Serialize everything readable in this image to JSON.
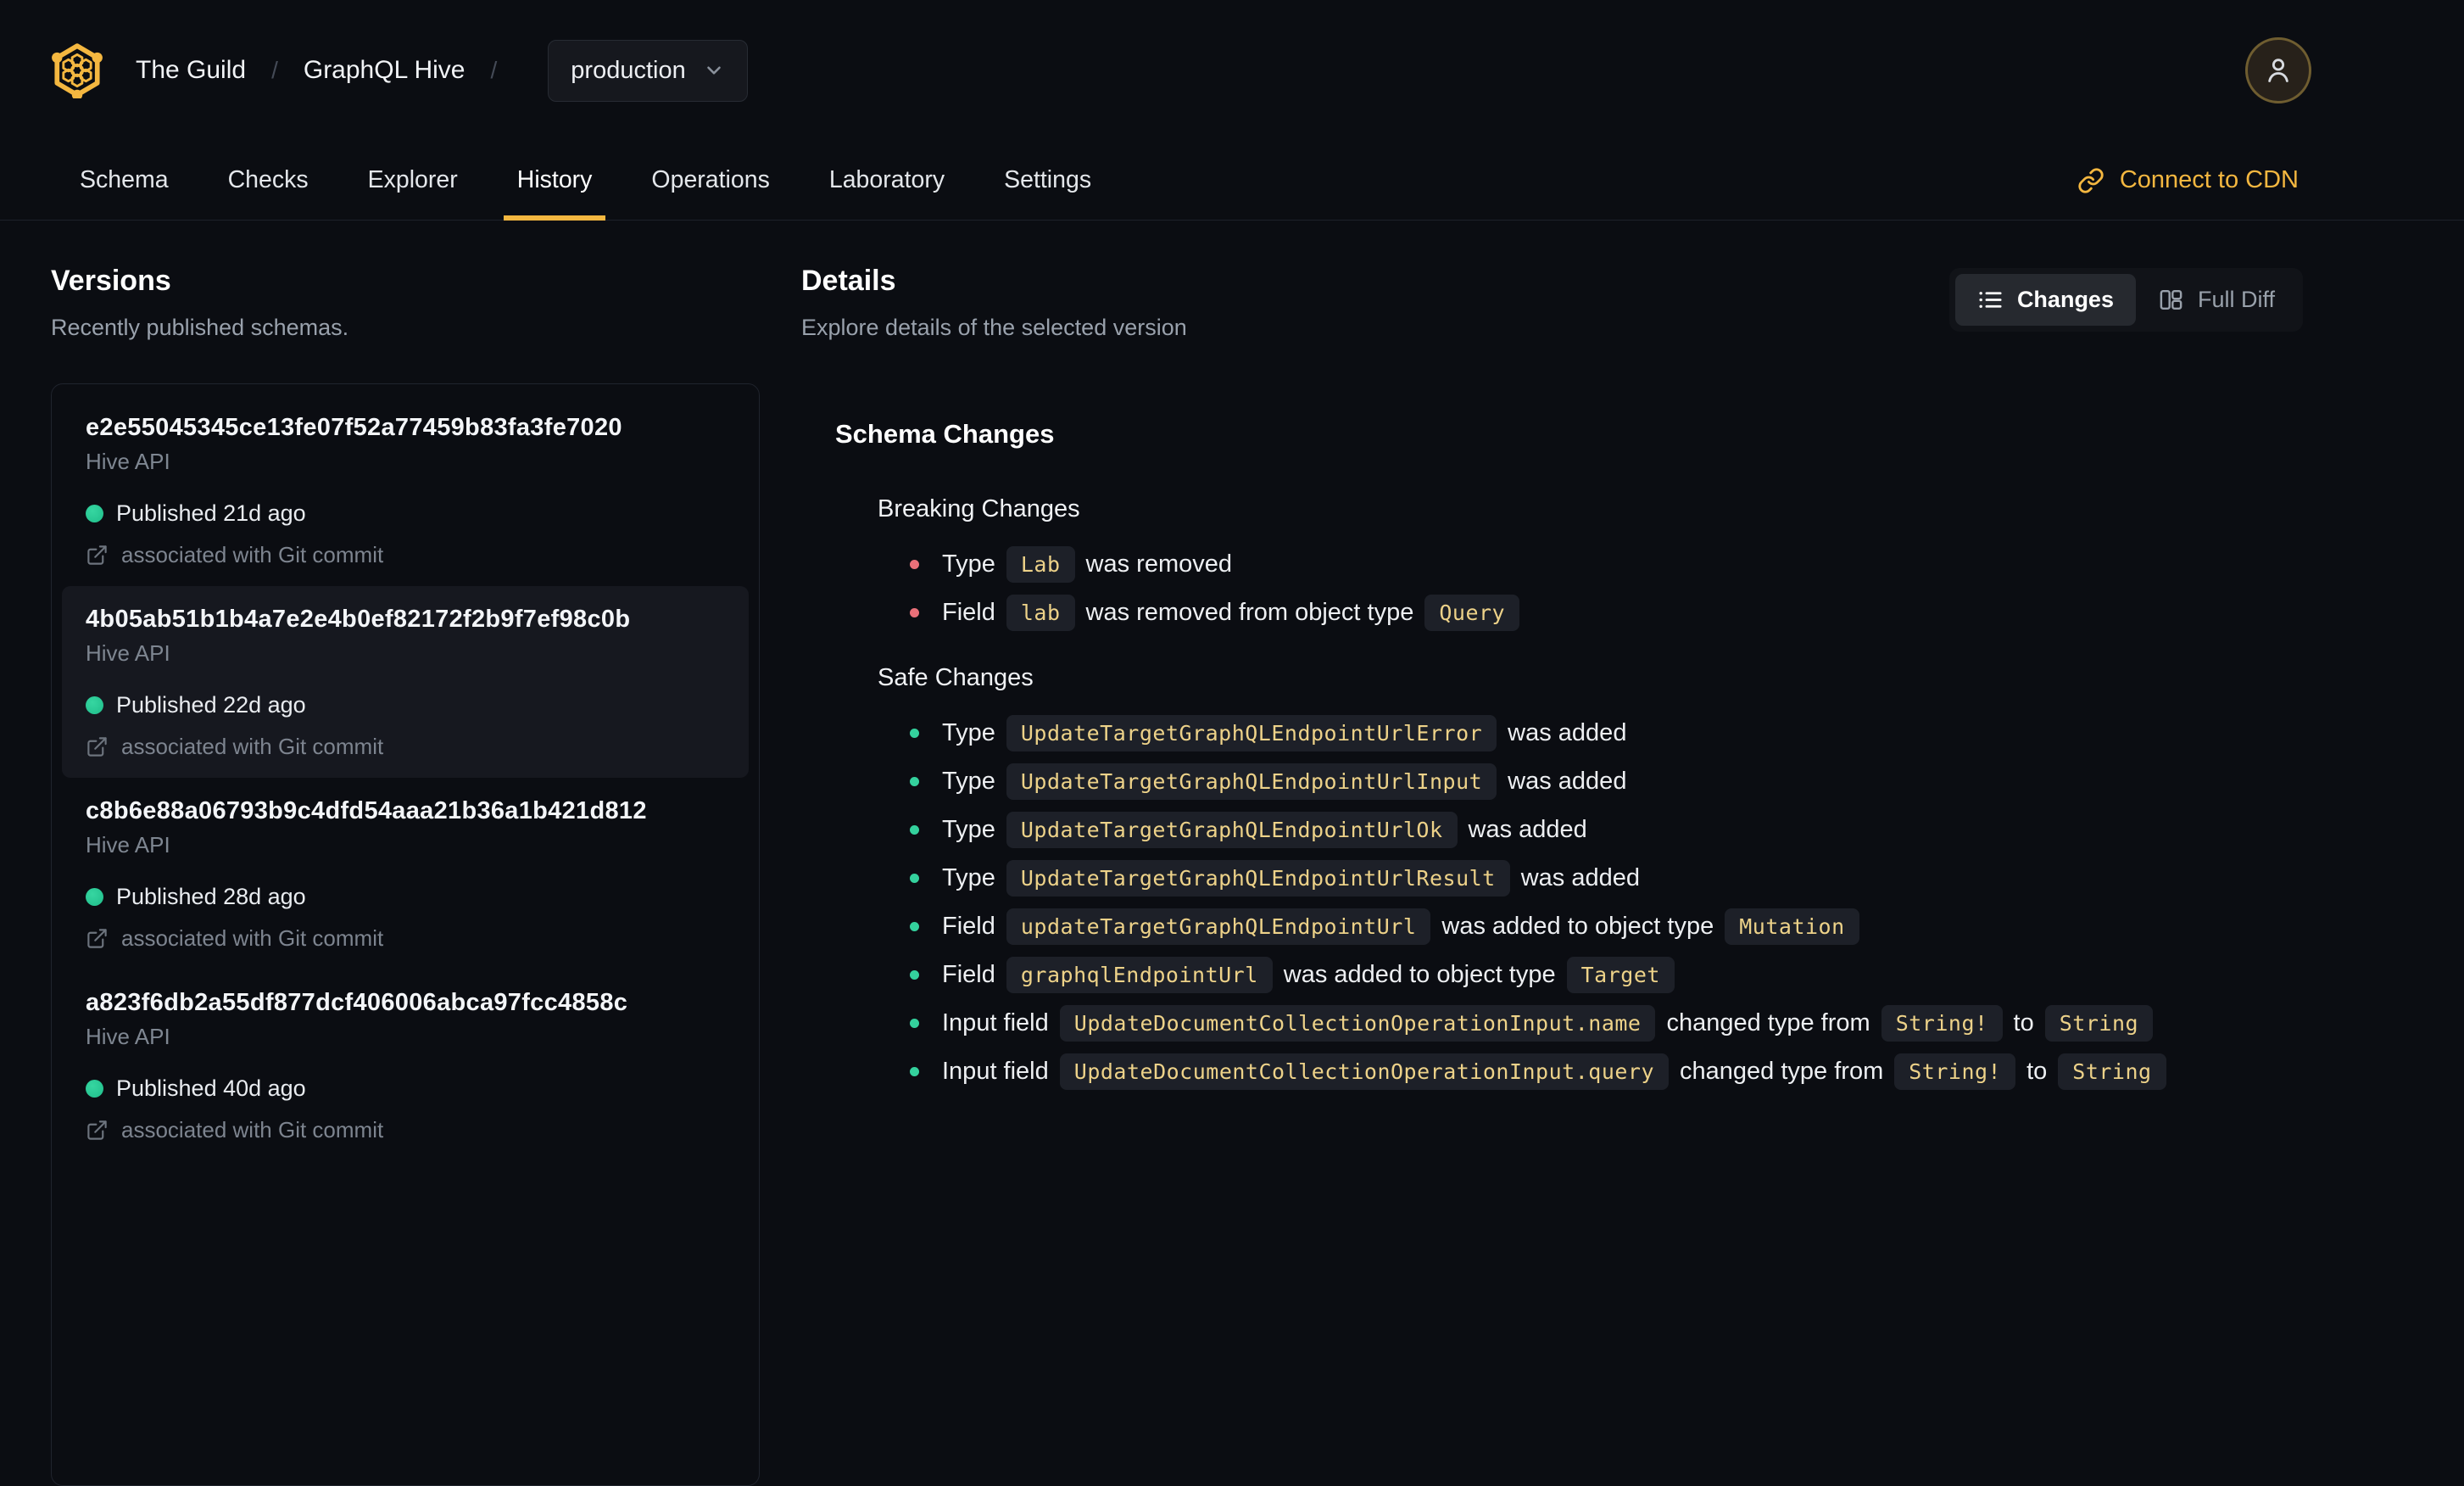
{
  "header": {
    "breadcrumb": {
      "org": "The Guild",
      "separator": "/",
      "project": "GraphQL Hive"
    },
    "target_selector": {
      "value": "production"
    }
  },
  "nav": {
    "tabs": [
      {
        "label": "Schema",
        "active": false
      },
      {
        "label": "Checks",
        "active": false
      },
      {
        "label": "Explorer",
        "active": false
      },
      {
        "label": "History",
        "active": true
      },
      {
        "label": "Operations",
        "active": false
      },
      {
        "label": "Laboratory",
        "active": false
      },
      {
        "label": "Settings",
        "active": false
      }
    ],
    "cdn_link": "Connect to CDN"
  },
  "versions": {
    "title": "Versions",
    "subtitle": "Recently published schemas.",
    "items": [
      {
        "hash": "e2e55045345ce13fe07f52a77459b83fa3fe7020",
        "service": "Hive API",
        "published": "Published 21d ago",
        "git": "associated with Git commit",
        "selected": false
      },
      {
        "hash": "4b05ab51b1b4a7e2e4b0ef82172f2b9f7ef98c0b",
        "service": "Hive API",
        "published": "Published 22d ago",
        "git": "associated with Git commit",
        "selected": true
      },
      {
        "hash": "c8b6e88a06793b9c4dfd54aaa21b36a1b421d812",
        "service": "Hive API",
        "published": "Published 28d ago",
        "git": "associated with Git commit",
        "selected": false
      },
      {
        "hash": "a823f6db2a55df877dcf406006abca97fcc4858c",
        "service": "Hive API",
        "published": "Published 40d ago",
        "git": "associated with Git commit",
        "selected": false
      }
    ]
  },
  "details": {
    "title": "Details",
    "subtitle": "Explore details of the selected version",
    "view_toggle": {
      "changes_label": "Changes",
      "full_diff_label": "Full Diff",
      "active": "changes"
    },
    "schema_changes": {
      "title": "Schema Changes",
      "breaking": {
        "title": "Breaking Changes",
        "items": [
          [
            {
              "text": "Type"
            },
            {
              "code": "Lab"
            },
            {
              "text": "was removed"
            }
          ],
          [
            {
              "text": "Field"
            },
            {
              "code": "lab"
            },
            {
              "text": "was removed from object type"
            },
            {
              "code": "Query"
            }
          ]
        ]
      },
      "safe": {
        "title": "Safe Changes",
        "items": [
          [
            {
              "text": "Type"
            },
            {
              "code": "UpdateTargetGraphQLEndpointUrlError"
            },
            {
              "text": "was added"
            }
          ],
          [
            {
              "text": "Type"
            },
            {
              "code": "UpdateTargetGraphQLEndpointUrlInput"
            },
            {
              "text": "was added"
            }
          ],
          [
            {
              "text": "Type"
            },
            {
              "code": "UpdateTargetGraphQLEndpointUrlOk"
            },
            {
              "text": "was added"
            }
          ],
          [
            {
              "text": "Type"
            },
            {
              "code": "UpdateTargetGraphQLEndpointUrlResult"
            },
            {
              "text": "was added"
            }
          ],
          [
            {
              "text": "Field"
            },
            {
              "code": "updateTargetGraphQLEndpointUrl"
            },
            {
              "text": "was added to object type"
            },
            {
              "code": "Mutation"
            }
          ],
          [
            {
              "text": "Field"
            },
            {
              "code": "graphqlEndpointUrl"
            },
            {
              "text": "was added to object type"
            },
            {
              "code": "Target"
            }
          ],
          [
            {
              "text": "Input field"
            },
            {
              "code": "UpdateDocumentCollectionOperationInput.name"
            },
            {
              "text": "changed type from"
            },
            {
              "code": "String!"
            },
            {
              "text": "to"
            },
            {
              "code": "String"
            }
          ],
          [
            {
              "text": "Input field"
            },
            {
              "code": "UpdateDocumentCollectionOperationInput.query"
            },
            {
              "text": "changed type from"
            },
            {
              "code": "String!"
            },
            {
              "text": "to"
            },
            {
              "code": "String"
            }
          ]
        ]
      }
    }
  },
  "icons": [
    "hive-logo-icon",
    "chevron-down-icon",
    "user-icon",
    "link-icon",
    "list-icon",
    "columns-icon",
    "status-dot-icon",
    "external-link-icon"
  ],
  "colors": {
    "accent": "#f4b740",
    "breaking": "#e97079",
    "safe": "#34d19d",
    "published": "#1fbd8a",
    "badge_text": "#edd289",
    "background": "#0b0d12"
  }
}
